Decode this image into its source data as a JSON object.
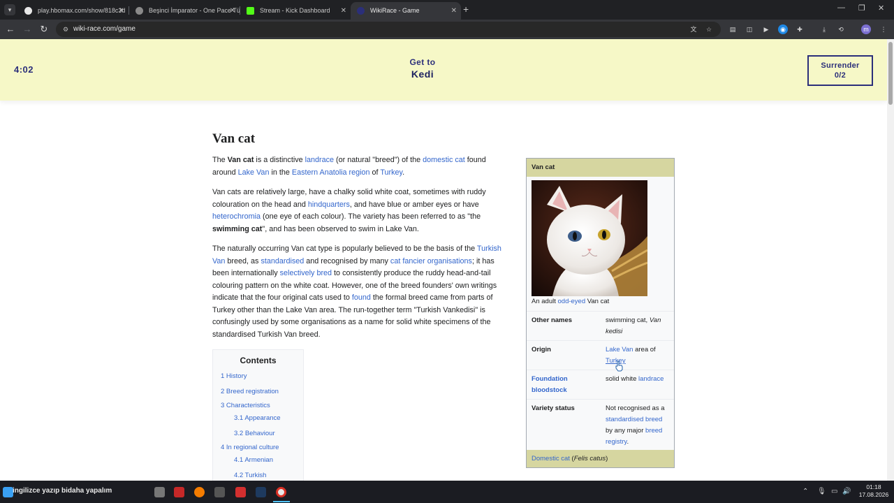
{
  "browser": {
    "tabs": [
      {
        "title": "play.hbomax.com/show/818c3d",
        "active": false
      },
      {
        "title": "Beşinci İmparator - One Pace Tü",
        "active": false
      },
      {
        "title": "Stream - Kick Dashboard",
        "active": false
      },
      {
        "title": "WikiRace - Game",
        "active": true
      }
    ],
    "url": "wiki-race.com/game",
    "profile_initial": "m"
  },
  "game": {
    "timer": "4:02",
    "goal_label": "Get to",
    "goal_target": "Kedi",
    "surrender_label": "Surrender",
    "surrender_count": "0/2"
  },
  "article": {
    "title": "Van cat",
    "p1": {
      "t1": "The ",
      "b1": "Van cat",
      "t2": " is a distinctive ",
      "a1": "landrace",
      "t3": " (or natural \"breed\") of the ",
      "a2": "domestic cat",
      "t4": " found around ",
      "a3": "Lake Van",
      "t5": " in the ",
      "a4": "Eastern Anatolia region",
      "t6": " of ",
      "a5": "Turkey",
      "t7": "."
    },
    "p2": {
      "t1": "Van cats are relatively large, have a chalky solid white coat, sometimes with ruddy colouration on the head and ",
      "a1": "hindquarters",
      "t2": ", and have blue or amber eyes or have ",
      "a2": "heterochromia",
      "t3": " (one eye of each colour). The variety has been referred to as \"the ",
      "b1": "swimming cat",
      "t4": "\", and has been observed to swim in Lake Van."
    },
    "p3": {
      "t1": "The naturally occurring Van cat type is popularly believed to be the basis of the ",
      "a1": "Turkish Van",
      "t2": " breed, as ",
      "a2": "standardised",
      "t3": " and recognised by many ",
      "a3": "cat fancier organisations",
      "t4": "; it has been internationally ",
      "a4": "selectively bred",
      "t5": " to consistently produce the ruddy head-and-tail colouring pattern on the white coat. However, one of the breed founders' own writings indicate that the four original cats used to ",
      "a5": "found",
      "t6": " the formal breed came from parts of Turkey other than the Lake Van area. The run-together term \"Turkish Vankedisi\" is confusingly used by some organisations as a name for solid white specimens of the standardised Turkish Van breed."
    }
  },
  "toc": {
    "title": "Contents",
    "items": [
      {
        "label": "1 History",
        "level": 1
      },
      {
        "label": "2 Breed registration",
        "level": 1
      },
      {
        "label": "3 Characteristics",
        "level": 1
      },
      {
        "label": "3.1 Appearance",
        "level": 2
      },
      {
        "label": "3.2 Behaviour",
        "level": 2
      },
      {
        "label": "4 In regional culture",
        "level": 1
      },
      {
        "label": "4.1 Armenian",
        "level": 2
      },
      {
        "label": "4.2 Turkish",
        "level": 2
      }
    ]
  },
  "infobox": {
    "title": "Van cat",
    "caption_pre": "An adult ",
    "caption_link": "odd-eyed",
    "caption_post": " Van cat",
    "other_names_label": "Other names",
    "other_names_value_1": "swimming cat, ",
    "other_names_value_2": "Van kedisi",
    "origin_label": "Origin",
    "origin_link1": "Lake Van",
    "origin_text": " area of ",
    "origin_link2": "Turkey",
    "foundation_label": "Foundation bloodstock",
    "foundation_text": "solid white ",
    "foundation_link": "landrace",
    "variety_label": "Variety status",
    "variety_text1": "Not recognised as a ",
    "variety_link1": "standardised breed",
    "variety_text2": " by any major ",
    "variety_link2": "breed registry",
    "variety_text3": ".",
    "footer_link": "Domestic cat",
    "footer_text_1": " (",
    "footer_italic": "Felis catus",
    "footer_text_2": ")"
  },
  "taskbar": {
    "search_text": "ingilizce yazıp bidaha yapalım",
    "time": "01:18",
    "date": "17.08.2026"
  },
  "colors": {
    "header_bg": "#f6f8c7",
    "game_navy": "#2b2f7a",
    "link": "#3366cc",
    "infobox_header": "#d6d6a0"
  }
}
